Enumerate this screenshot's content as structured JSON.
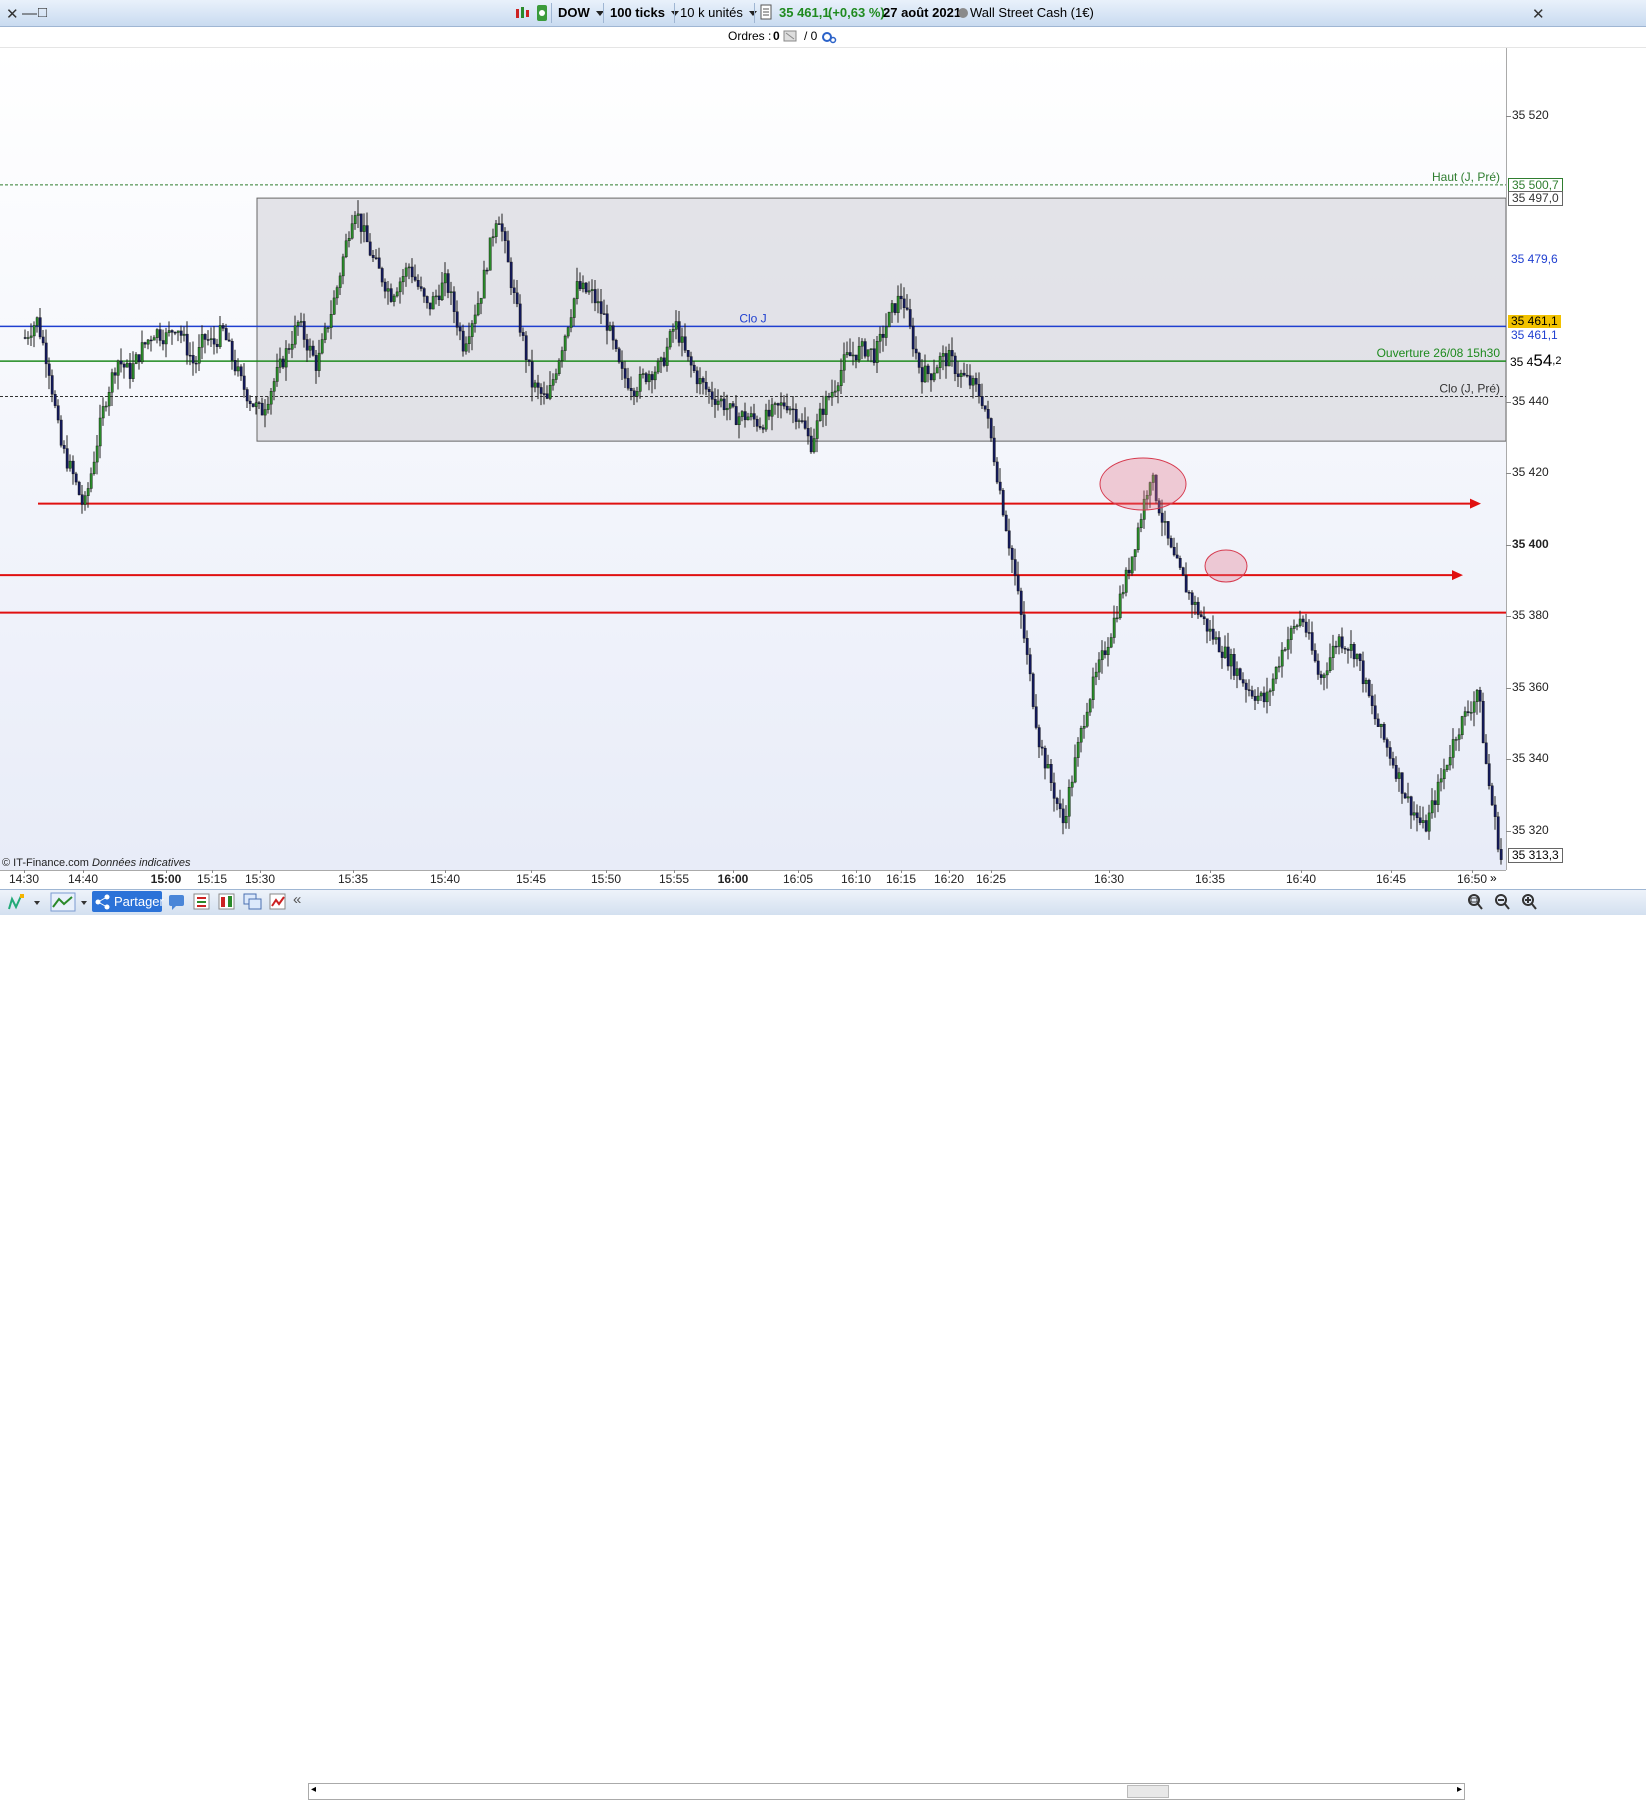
{
  "toolbar": {
    "instrument": "DOW",
    "ticks": "100 ticks",
    "units": "10 k unités",
    "price": "35 461,1",
    "change": "(+0,63 %)",
    "date": "27 août 2021",
    "market": "Wall Street Cash (1€)"
  },
  "orders": {
    "label": "Ordres :",
    "count1": "0",
    "count2": "/ 0"
  },
  "footer": {
    "copyright": "© IT-Finance.com",
    "note": "Données indicatives",
    "share": "Partager"
  },
  "chart_data": {
    "type": "candlestick",
    "y_ticks": [
      "35 520",
      "35 440",
      "35 420",
      "35 400",
      "35 380",
      "35 360",
      "35 340",
      "35 320"
    ],
    "ylim": [
      35309,
      35539
    ],
    "x_ticks": [
      "14:30",
      "14:40",
      "15:00",
      "15:15",
      "15:30",
      "15:35",
      "15:40",
      "15:45",
      "15:50",
      "15:55",
      "16:00",
      "16:05",
      "16:10",
      "16:15",
      "16:20",
      "16:25",
      "16:30",
      "16:35",
      "16:40",
      "16:45",
      "16:50"
    ],
    "x_ticks_bold": [
      "15:00",
      "16:00"
    ],
    "levels": [
      {
        "label": "Haut (J, Pré)",
        "value": 35500.7,
        "value_label": "35 500,7",
        "color": "#2f7d2f",
        "style": "dashed"
      },
      {
        "label": "",
        "value": 35497.0,
        "value_label": "35 497,0",
        "color": "#555555",
        "style": "box"
      },
      {
        "label": "",
        "value": 35479.6,
        "value_label": "35 479,6",
        "color": "#1f3fd0",
        "style": "label"
      },
      {
        "label": "Clo J",
        "value": 35461.1,
        "value_label": "35 461,1",
        "color": "#1f3fd0",
        "style": "solid"
      },
      {
        "label": "Ouverture 26/08 15h30",
        "value": 35451.4,
        "value_label": "35 451,4",
        "color": "#1e8a1e",
        "style": "solid"
      },
      {
        "label": "Clo (J, Pré)",
        "value": 35441.5,
        "value_label": "",
        "color": "#333333",
        "style": "dashed"
      }
    ],
    "current_price": {
      "value": 35461.1,
      "label": "35 461,1",
      "color": "#f2c200"
    },
    "crosshair_value": {
      "main": "35 4",
      "big": "54",
      "small": ",2"
    },
    "last_price": {
      "value": 35313.3,
      "label": "35 313,3"
    },
    "range_box": {
      "high": 35497.0,
      "low": 35429.0,
      "x_start": "15:30",
      "x_end": "16:50"
    },
    "red_lines": [
      35411.5,
      35391.5,
      35381.0
    ],
    "highlights": [
      {
        "x_time": "16:31",
        "y": 35413,
        "note": "rejection"
      },
      {
        "x_time": "16:35",
        "y": 35391,
        "note": "rejection"
      }
    ],
    "price_path": [
      [
        "14:30",
        35458
      ],
      [
        "14:32",
        35463
      ],
      [
        "14:34",
        35450
      ],
      [
        "14:36",
        35428
      ],
      [
        "14:38",
        35420
      ],
      [
        "14:40",
        35410
      ],
      [
        "14:42",
        35422
      ],
      [
        "14:45",
        35440
      ],
      [
        "14:48",
        35452
      ],
      [
        "14:51",
        35448
      ],
      [
        "14:54",
        35455
      ],
      [
        "14:57",
        35460
      ],
      [
        "15:00",
        35458
      ],
      [
        "15:03",
        35462
      ],
      [
        "15:06",
        35456
      ],
      [
        "15:09",
        35450
      ],
      [
        "15:12",
        35458
      ],
      [
        "15:15",
        35456
      ],
      [
        "15:18",
        35460
      ],
      [
        "15:21",
        35452
      ],
      [
        "15:24",
        35445
      ],
      [
        "15:27",
        35440
      ],
      [
        "15:30",
        35437
      ],
      [
        "15:32",
        35462
      ],
      [
        "15:33",
        35450
      ],
      [
        "15:34",
        35470
      ],
      [
        "15:35",
        35495
      ],
      [
        "15:36",
        35480
      ],
      [
        "15:37",
        35470
      ],
      [
        "15:38",
        35478
      ],
      [
        "15:39",
        35466
      ],
      [
        "15:40",
        35474
      ],
      [
        "15:41",
        35456
      ],
      [
        "15:42",
        35470
      ],
      [
        "15:43",
        35494
      ],
      [
        "15:44",
        35468
      ],
      [
        "15:45",
        35445
      ],
      [
        "15:46",
        35440
      ],
      [
        "15:47",
        35456
      ],
      [
        "15:48",
        35472
      ],
      [
        "15:49",
        35470
      ],
      [
        "15:50",
        35462
      ],
      [
        "15:51",
        35448
      ],
      [
        "15:52",
        35444
      ],
      [
        "15:53",
        35448
      ],
      [
        "15:54",
        35450
      ],
      [
        "15:55",
        35462
      ],
      [
        "15:56",
        35452
      ],
      [
        "15:57",
        35446
      ],
      [
        "15:58",
        35442
      ],
      [
        "15:59",
        35440
      ],
      [
        "16:00",
        35436
      ],
      [
        "16:01",
        35436
      ],
      [
        "16:02",
        35434
      ],
      [
        "16:03",
        35437
      ],
      [
        "16:04",
        35440
      ],
      [
        "16:05",
        35436
      ],
      [
        "16:06",
        35428
      ],
      [
        "16:07",
        35438
      ],
      [
        "16:08",
        35444
      ],
      [
        "16:09",
        35452
      ],
      [
        "16:10",
        35454
      ],
      [
        "16:11",
        35455
      ],
      [
        "16:12",
        35453
      ],
      [
        "16:13",
        35460
      ],
      [
        "16:14",
        35466
      ],
      [
        "16:15",
        35470
      ],
      [
        "16:16",
        35458
      ],
      [
        "16:17",
        35448
      ],
      [
        "16:18",
        35448
      ],
      [
        "16:19",
        35452
      ],
      [
        "16:20",
        35452
      ],
      [
        "16:21",
        35448
      ],
      [
        "16:22",
        35446
      ],
      [
        "16:23",
        35444
      ],
      [
        "16:24",
        35440
      ],
      [
        "16:25",
        35428
      ],
      [
        "16:26",
        35390
      ],
      [
        "16:27",
        35345
      ],
      [
        "16:28",
        35322
      ],
      [
        "16:29",
        35355
      ],
      [
        "16:30",
        35375
      ],
      [
        "16:31",
        35395
      ],
      [
        "16:32",
        35420
      ],
      [
        "16:33",
        35398
      ],
      [
        "16:34",
        35385
      ],
      [
        "16:35",
        35375
      ],
      [
        "16:36",
        35368
      ],
      [
        "16:37",
        35360
      ],
      [
        "16:38",
        35356
      ],
      [
        "16:39",
        35372
      ],
      [
        "16:40",
        35380
      ],
      [
        "16:41",
        35362
      ],
      [
        "16:42",
        35374
      ],
      [
        "16:43",
        35370
      ],
      [
        "16:44",
        35352
      ],
      [
        "16:45",
        35340
      ],
      [
        "16:46",
        35328
      ],
      [
        "16:47",
        35320
      ],
      [
        "16:48",
        35334
      ],
      [
        "16:49",
        35348
      ],
      [
        "16:50",
        35356
      ],
      [
        "16:51",
        35360
      ],
      [
        "16:52",
        35348
      ],
      [
        "16:53",
        35336
      ],
      [
        "16:54",
        35328
      ],
      [
        "16:55",
        35320
      ],
      [
        "16:56",
        35312
      ]
    ]
  }
}
